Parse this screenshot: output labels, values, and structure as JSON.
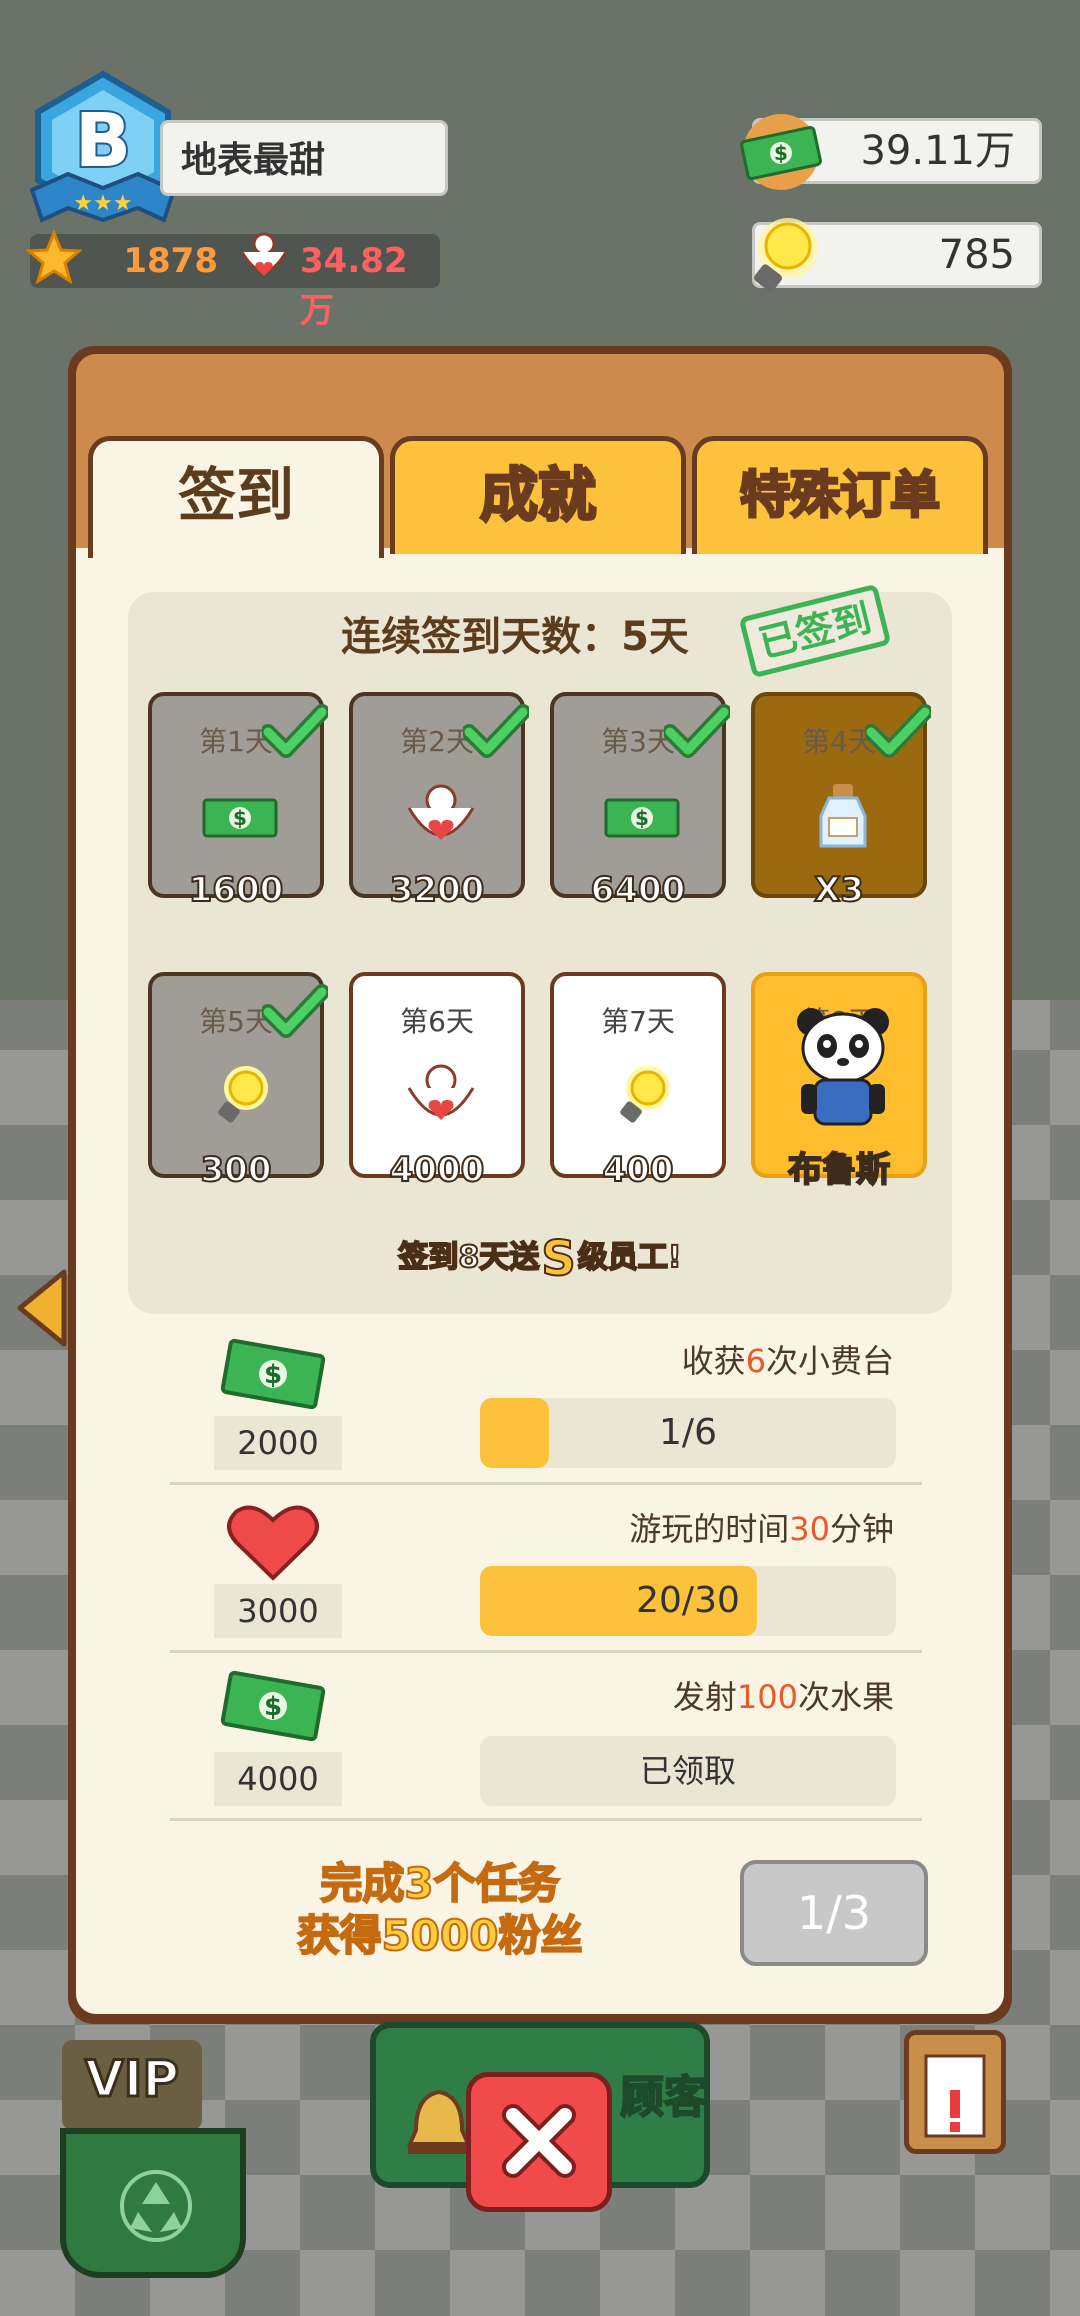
{
  "player": {
    "rank": "B",
    "name": "地表最甜",
    "stars": "1878",
    "fans": "34.82万"
  },
  "resources": {
    "cash": "39.11万",
    "bulbs": "785"
  },
  "tabs": [
    "签到",
    "成就",
    "特殊订单"
  ],
  "checkin": {
    "streak_text": "连续签到天数：5天",
    "signed_stamp": "已签到",
    "days": [
      {
        "label": "第1天",
        "value": "1600",
        "reward": "cash",
        "state": "claimed"
      },
      {
        "label": "第2天",
        "value": "3200",
        "reward": "fans",
        "state": "claimed"
      },
      {
        "label": "第3天",
        "value": "6400",
        "reward": "cash",
        "state": "claimed"
      },
      {
        "label": "第4天",
        "value": "X3",
        "reward": "bottle",
        "state": "claimed"
      },
      {
        "label": "第5天",
        "value": "300",
        "reward": "bulb",
        "state": "claimed"
      },
      {
        "label": "第6天",
        "value": "4000",
        "reward": "fans",
        "state": "open"
      },
      {
        "label": "第7天",
        "value": "400",
        "reward": "bulb",
        "state": "open"
      },
      {
        "label": "第8天",
        "value": "布鲁斯",
        "reward": "panda-staff",
        "state": "special"
      }
    ],
    "bonus_before": "签到8天送",
    "bonus_grade": "S",
    "bonus_after": "级员工!"
  },
  "tasks": [
    {
      "title_pre": "收获",
      "title_num": "6",
      "title_post": "次小费台",
      "reward": "2000",
      "icon": "cash",
      "progress_text": "1/6",
      "progress": 0.167
    },
    {
      "title_pre": "游玩的时间",
      "title_num": "30",
      "title_post": "分钟",
      "reward": "3000",
      "icon": "heart",
      "progress_text": "20/30",
      "progress": 0.667
    },
    {
      "title_pre": "发射",
      "title_num": "100",
      "title_post": "次水果",
      "reward": "4000",
      "icon": "cash",
      "status": "已领取"
    }
  ],
  "footer": {
    "line1": "完成3个任务",
    "line2": "获得5000粉丝",
    "button": "1/3"
  },
  "bottom": {
    "vip": "VIP",
    "customer_label": "顾客"
  },
  "colors": {
    "accent": "#fdc23c",
    "panel_brown": "#6b3b1f",
    "highlight": "#e85a2a",
    "check_green": "#3cb453",
    "close_red": "#f04a4a"
  }
}
